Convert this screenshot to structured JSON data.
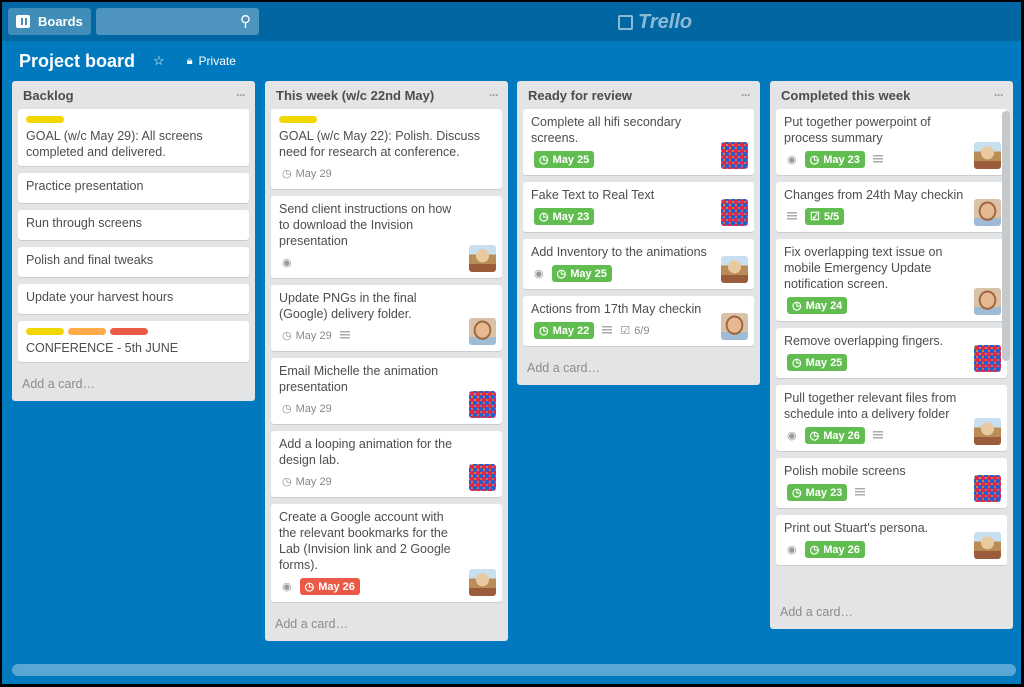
{
  "header": {
    "boards_label": "Boards",
    "search_placeholder": "",
    "logo": "Trello"
  },
  "board": {
    "title": "Project board",
    "visibility": "Private"
  },
  "add_card_label": "Add a card…",
  "colors": {
    "board_bg": "#0079bf",
    "green": "#61bd4f",
    "red": "#eb5a46",
    "yellow": "#f2d600",
    "orange": "#ffab4a",
    "label_red": "#eb5a46"
  },
  "lists": [
    {
      "title": "Backlog",
      "cards": [
        {
          "labels": [
            "#f2d600"
          ],
          "text": "GOAL (w/c May 29): All screens completed and delivered."
        },
        {
          "text": "Practice presentation"
        },
        {
          "text": "Run through screens"
        },
        {
          "text": "Polish and final tweaks"
        },
        {
          "text": "Update your harvest hours"
        },
        {
          "labels": [
            "#f2d600",
            "#ffab4a",
            "#eb5a46"
          ],
          "text": "CONFERENCE - 5th JUNE"
        }
      ]
    },
    {
      "title": "This week (w/c 22nd May)",
      "cards": [
        {
          "labels": [
            "#f2d600"
          ],
          "text": "GOAL (w/c May 22): Polish. Discuss need for research at conference.",
          "due": "May 29",
          "due_status": "none"
        },
        {
          "text": "Send client instructions on how to download the Invision presentation",
          "watch": true,
          "avatar": "woman"
        },
        {
          "text": "Update PNGs in the final (Google) delivery folder.",
          "due": "May 29",
          "due_status": "none",
          "description": true,
          "avatar": "man"
        },
        {
          "text": "Email Michelle the animation presentation",
          "due": "May 29",
          "due_status": "none",
          "avatar": "pattern"
        },
        {
          "text": "Add a looping animation for the design lab.",
          "due": "May 29",
          "due_status": "none",
          "avatar": "pattern"
        },
        {
          "text": "Create a Google account with the relevant bookmarks for the Lab (Invision link and 2 Google forms).",
          "watch": true,
          "due": "May 26",
          "due_status": "red",
          "avatar": "woman"
        }
      ]
    },
    {
      "title": "Ready for review",
      "cards": [
        {
          "text": "Complete all hifi secondary screens.",
          "due": "May 25",
          "due_status": "green",
          "avatar": "pattern"
        },
        {
          "text": "Fake Text to Real Text",
          "due": "May 23",
          "due_status": "green",
          "avatar": "pattern"
        },
        {
          "text": "Add Inventory to the animations",
          "watch": true,
          "due": "May 25",
          "due_status": "green",
          "avatar": "woman"
        },
        {
          "text": "Actions from 17th May checkin",
          "due": "May 22",
          "due_status": "green",
          "description": true,
          "checklist": "6/9",
          "checklist_status": "none",
          "avatar": "man"
        }
      ]
    },
    {
      "title": "Completed this week",
      "cards": [
        {
          "text": "Put together powerpoint of process summary",
          "watch": true,
          "due": "May 23",
          "due_status": "green",
          "description": true,
          "avatar": "woman"
        },
        {
          "text": "Changes from 24th May checkin",
          "description": true,
          "checklist": "5/5",
          "checklist_status": "green",
          "avatar": "man"
        },
        {
          "text": "Fix overlapping text issue on mobile Emergency Update notification screen.",
          "due": "May 24",
          "due_status": "green",
          "avatar": "man"
        },
        {
          "text": "Remove overlapping fingers.",
          "due": "May 25",
          "due_status": "green",
          "avatar": "pattern"
        },
        {
          "text": "Pull together relevant files from schedule into a delivery folder",
          "watch": true,
          "due": "May 26",
          "due_status": "green",
          "description": true,
          "avatar": "woman"
        },
        {
          "text": "Polish mobile screens",
          "due": "May 23",
          "due_status": "green",
          "description": true,
          "avatar": "pattern"
        },
        {
          "text": "Print out Stuart's persona.",
          "watch": true,
          "due": "May 26",
          "due_status": "green",
          "avatar": "woman"
        }
      ]
    }
  ]
}
